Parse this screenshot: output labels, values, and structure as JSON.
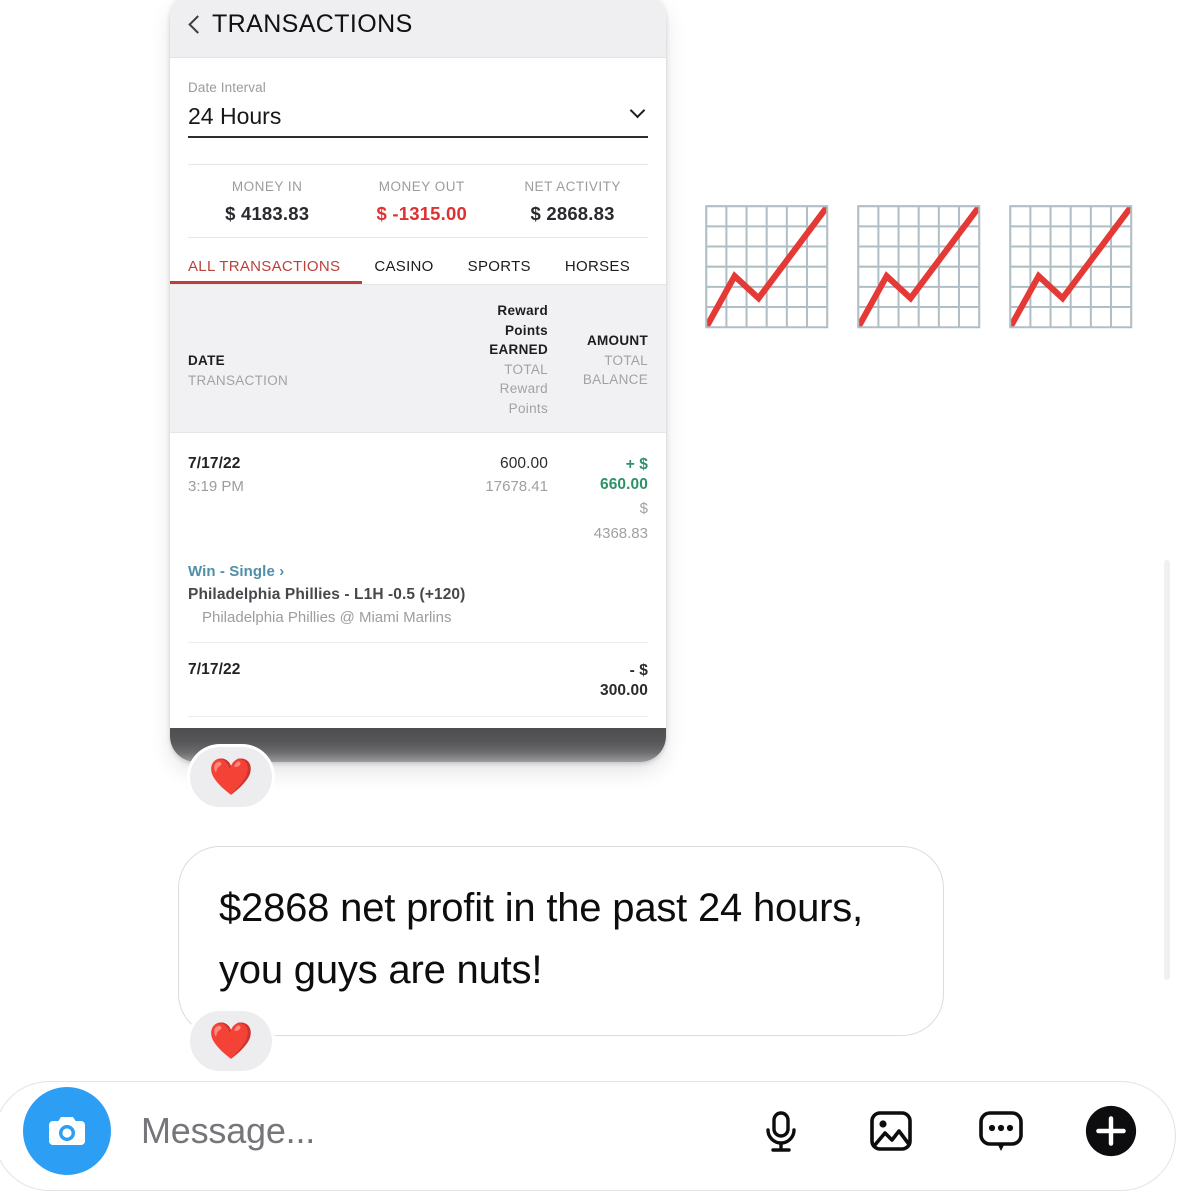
{
  "attachment": {
    "header": {
      "back_icon": "back-chevron-icon",
      "title": "TRANSACTIONS"
    },
    "date_interval": {
      "label": "Date Interval",
      "value": "24 Hours",
      "chevron_icon": "chevron-down-icon"
    },
    "summary": [
      {
        "label": "MONEY IN",
        "value": "$ 4183.83",
        "tone": "neutral"
      },
      {
        "label": "MONEY OUT",
        "value": "$ -1315.00",
        "tone": "negative"
      },
      {
        "label": "NET ACTIVITY",
        "value": "$ 2868.83",
        "tone": "neutral"
      }
    ],
    "tabs": [
      {
        "label": "ALL TRANSACTIONS",
        "active": true
      },
      {
        "label": "CASINO",
        "active": false
      },
      {
        "label": "SPORTS",
        "active": false
      },
      {
        "label": "HORSES",
        "active": false
      }
    ],
    "table_header": {
      "date_primary": "DATE",
      "date_secondary": "TRANSACTION",
      "points_primary_line1": "Reward",
      "points_primary_line2": "Points",
      "points_primary_line3": "EARNED",
      "points_secondary_line1": "TOTAL",
      "points_secondary_line2": "Reward",
      "points_secondary_line3": "Points",
      "amount_primary": "AMOUNT",
      "amount_secondary_line1": "TOTAL",
      "amount_secondary_line2": "BALANCE"
    },
    "rows": [
      {
        "date": "7/17/22",
        "time": "3:19 PM",
        "points_earned": "600.00",
        "points_total": "17678.41",
        "amount": "+ $ 660.00",
        "amount_line1": "+ $",
        "amount_line2": "660.00",
        "balance_line1": "$",
        "balance_line2": "4368.83",
        "bet_type": "Win - Single",
        "bet_arrow": "›",
        "bet_title": "Philadelphia Phillies - L1H -0.5 (+120)",
        "bet_matchup": "Philadelphia Phillies @ Miami Marlins"
      },
      {
        "date": "7/17/22",
        "amount_line1": "- $",
        "amount_line2": "300.00"
      }
    ]
  },
  "emoji_row": {
    "icons": [
      "chart-increasing-icon",
      "chart-increasing-icon",
      "chart-increasing-icon"
    ],
    "glyph": "📈"
  },
  "reactions": {
    "heart_glyph": "❤️",
    "attachment_reaction_name": "heart-reaction-on-attachment",
    "message_reaction_name": "heart-reaction-on-message"
  },
  "message": {
    "text": "$2868 net profit in the past 24 hours, you guys are nuts!"
  },
  "composer": {
    "camera_icon": "camera-icon",
    "placeholder": "Message...",
    "actions": [
      {
        "name": "microphone-icon"
      },
      {
        "name": "photo-gallery-icon"
      },
      {
        "name": "sticker-icon"
      },
      {
        "name": "plus-icon"
      }
    ]
  },
  "colors": {
    "accent_red": "#b8413c",
    "negative_red": "#e03131",
    "positive_green": "#2e9168",
    "link_blue": "#4f8fa8",
    "camera_blue": "#2c9ef4"
  }
}
